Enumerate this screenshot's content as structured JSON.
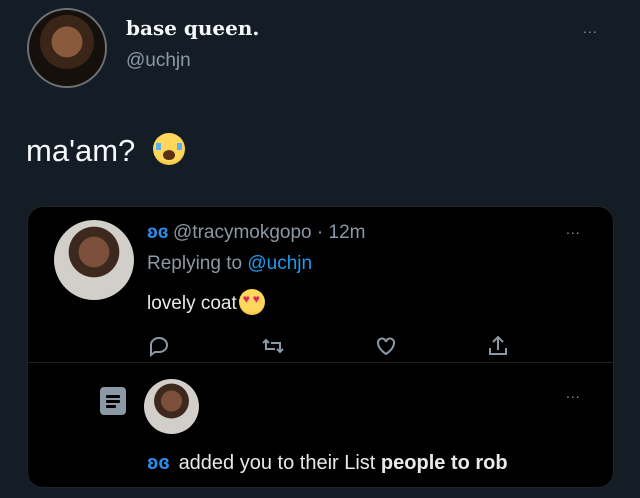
{
  "tweet": {
    "display_name": "base queen.",
    "handle": "@uchjn",
    "text": "ma'am?",
    "emoji": "crying-face",
    "more": "..."
  },
  "reply": {
    "handle": "@tracymokgopo",
    "time": "· 12m",
    "replying_label": "Replying to",
    "replying_to": "@uchjn",
    "text": "lovely coat",
    "emoji": "heart-eyes-face",
    "more": "..."
  },
  "list_notice": {
    "text": "added you to their List",
    "list_name": "people to rob",
    "more": "..."
  },
  "icons": {
    "reply": "reply-icon",
    "retweet": "retweet-icon",
    "like": "like-icon",
    "share": "share-icon",
    "list": "list-icon",
    "verified_butterfly": "butterfly-icon"
  },
  "colors": {
    "background": "#141d26",
    "card": "#000000",
    "accent": "#1d9bf0",
    "muted": "#8b98a5"
  }
}
